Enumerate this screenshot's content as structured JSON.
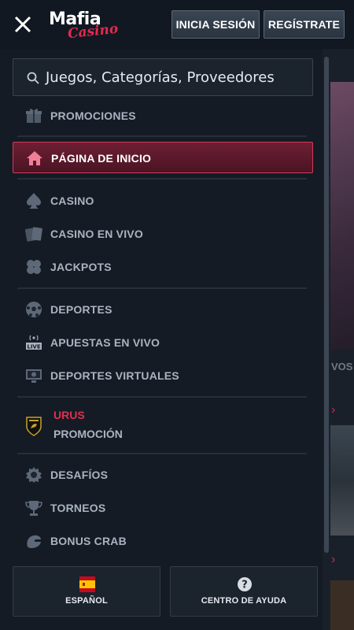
{
  "header": {
    "logo_word": "Mafia",
    "logo_script": "Casino",
    "login_label": "INICIA SESIÓN",
    "register_label": "REGÍSTRATE"
  },
  "search": {
    "placeholder": "Juegos, Categorías, Proveedores"
  },
  "menu": {
    "promotions": "PROMOCIONES",
    "home": "PÁGINA DE INICIO",
    "casino": "CASINO",
    "live_casino": "CASINO EN VIVO",
    "jackpots": "JACKPOTS",
    "sports": "DEPORTES",
    "live_bets": "APUESTAS EN VIVO",
    "virtual_sports": "DEPORTES VIRTUALES",
    "urus_title": "URUS",
    "urus_sub": "PROMOCIÓN",
    "challenges": "DESAFÍOS",
    "tournaments": "TORNEOS",
    "bonus_crab": "BONUS CRAB"
  },
  "footer": {
    "language": "ESPAÑOL",
    "help": "CENTRO DE AYUDA"
  },
  "background": {
    "vivo_fragment": "VOS"
  },
  "colors": {
    "accent": "#e0304f",
    "active_bg": "#6e1f33",
    "panel": "#141b24"
  }
}
